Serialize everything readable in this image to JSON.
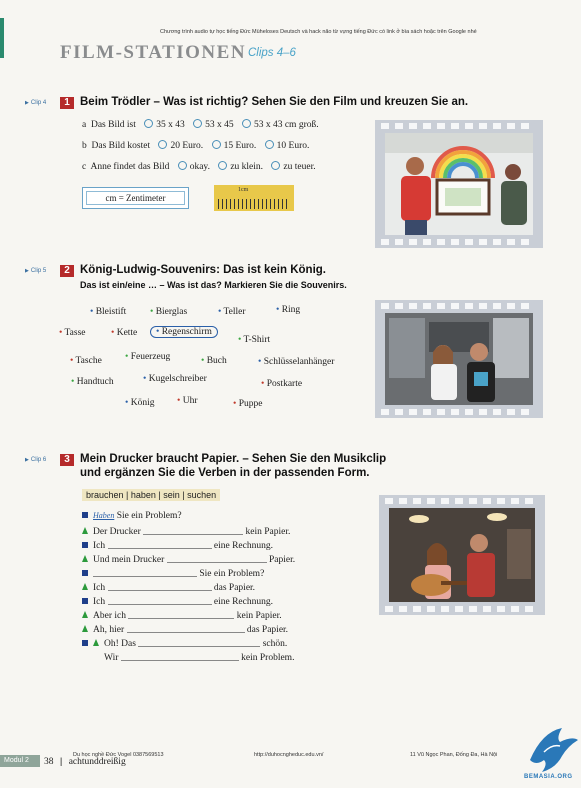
{
  "top_note": "Chương trình audio tự học tiếng Đức Müheloses Deutsch và hack não từ vựng tiếng Đức có link ở bìa sách hoặc trên Google nhé",
  "page_title": "FILM-STATIONEN",
  "clips_range": "Clips 4–6",
  "section1": {
    "clip": "Clip 4",
    "number": "1",
    "heading": "Beim Trödler – Was ist richtig? Sehen Sie den Film und kreuzen Sie an.",
    "questions": [
      {
        "letter": "a",
        "text": "Das Bild ist",
        "options": [
          "35 x 43",
          "53 x 45",
          "53 x 43"
        ],
        "suffix": "cm groß."
      },
      {
        "letter": "b",
        "text": "Das Bild kostet",
        "options": [
          "20 Euro.",
          "15 Euro.",
          "10 Euro."
        ],
        "suffix": ""
      },
      {
        "letter": "c",
        "text": "Anne findet das Bild",
        "options": [
          "okay.",
          "zu klein.",
          "zu teuer."
        ],
        "suffix": ""
      }
    ],
    "cm_note": "cm = Zentimeter",
    "ruler_label": "1cm"
  },
  "section2": {
    "clip": "Clip 5",
    "number": "2",
    "heading": "König-Ludwig-Souvenirs: Das ist kein König.",
    "subheading": "Das ist ein/eine … – Was ist das? Markieren Sie die Souvenirs.",
    "words": [
      {
        "text": "Bleistift",
        "color": "#2a5fa8"
      },
      {
        "text": "Bierglas",
        "color": "#3aa640"
      },
      {
        "text": "Teller",
        "color": "#2a5fa8"
      },
      {
        "text": "Ring",
        "color": "#2a5fa8"
      },
      {
        "text": "Tasse",
        "color": "#c0392b"
      },
      {
        "text": "Kette",
        "color": "#c0392b"
      },
      {
        "text": "Regenschirm",
        "color": "#2a5fa8"
      },
      {
        "text": "T-Shirt",
        "color": "#3aa640"
      },
      {
        "text": "Tasche",
        "color": "#c0392b"
      },
      {
        "text": "Feuerzeug",
        "color": "#3aa640"
      },
      {
        "text": "Buch",
        "color": "#3aa640"
      },
      {
        "text": "Schlüsselanhänger",
        "color": "#2a5fa8"
      },
      {
        "text": "Handtuch",
        "color": "#3aa640"
      },
      {
        "text": "Kugelschreiber",
        "color": "#2a5fa8"
      },
      {
        "text": "Postkarte",
        "color": "#c0392b"
      },
      {
        "text": "König",
        "color": "#2a5fa8"
      },
      {
        "text": "Uhr",
        "color": "#c0392b"
      },
      {
        "text": "Puppe",
        "color": "#c0392b"
      }
    ]
  },
  "section3": {
    "clip": "Clip 6",
    "number": "3",
    "heading_line1": "Mein Drucker braucht Papier. – Sehen Sie den Musikclip",
    "heading_line2": "und ergänzen Sie die Verben in der passenden Form.",
    "verbs": "brauchen | haben | sein | suchen",
    "lines": [
      {
        "marker": "square",
        "pre": "",
        "hand": "Haben",
        "post": "Sie ein Problem?"
      },
      {
        "marker": "triangle",
        "pre": "Der Drucker",
        "post": "kein Papier."
      },
      {
        "marker": "square",
        "pre": "Ich",
        "post": "eine Rechnung."
      },
      {
        "marker": "triangle",
        "pre": "Und mein Drucker",
        "post": "Papier."
      },
      {
        "marker": "square",
        "pre": "",
        "post": "Sie ein Problem?"
      },
      {
        "marker": "triangle",
        "pre": "Ich",
        "post": "das Papier."
      },
      {
        "marker": "square",
        "pre": "Ich",
        "post": "eine Rechnung."
      },
      {
        "marker": "triangle",
        "pre": "Aber ich",
        "post": "kein Papier."
      },
      {
        "marker": "triangle",
        "pre": "Ah, hier",
        "post": "das Papier."
      },
      {
        "marker": "both",
        "pre": "Oh! Das",
        "post": "schön."
      },
      {
        "marker": "none",
        "pre": "Wir",
        "post": "kein Problem."
      }
    ]
  },
  "footer": {
    "module": "Modul 2",
    "page_number": "38",
    "page_word": "achtunddreißig",
    "contact": "Du học nghề Đức Vogel 0387569513",
    "url": "http://duhocngheduc.edu.vn/",
    "address": "11 Vũ Ngọc Phan, Đống Đa, Hà Nội",
    "logo_text": "BEMASIA.ORG"
  }
}
